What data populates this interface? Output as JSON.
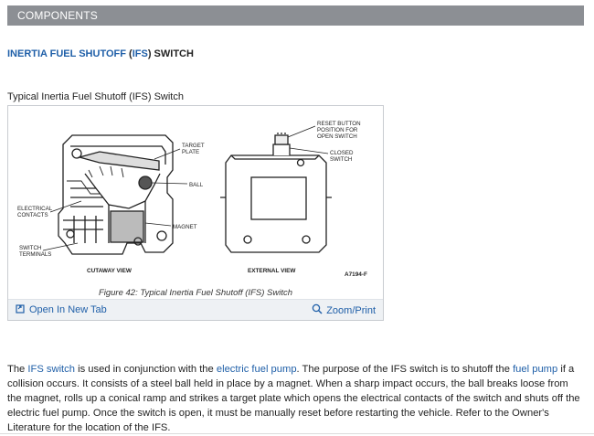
{
  "section_bar": {
    "label": "COMPONENTS"
  },
  "heading": {
    "part1": "INERTIA FUEL SHUTOFF",
    "part2": " (",
    "part3": "IFS",
    "part4": ") SWITCH"
  },
  "figure": {
    "title": "Typical Inertia Fuel Shutoff (IFS) Switch",
    "caption": "Figure 42: Typical Inertia Fuel Shutoff (IFS) Switch",
    "open_tab_label": "Open In New Tab",
    "zoom_label": "Zoom/Print",
    "diagram_labels": {
      "target_plate_1": "TARGET",
      "target_plate_2": "PLATE",
      "ball": "BALL",
      "contacts_1": "ELECTRICAL",
      "contacts_2": "CONTACTS",
      "magnet": "MAGNET",
      "terminals_1": "SWITCH",
      "terminals_2": "TERMINALS",
      "cutaway_view": "CUTAWAY VIEW",
      "reset_1": "RESET BUTTON",
      "reset_2": "POSITION FOR",
      "reset_3": "OPEN SWITCH",
      "closed_1": "CLOSED",
      "closed_2": "SWITCH",
      "external_view": "EXTERNAL VIEW",
      "figure_code": "A7194-F"
    }
  },
  "paragraph": {
    "t1": "The ",
    "l1": "IFS switch",
    "t2": " is used in conjunction with the ",
    "l2": "electric fuel pump",
    "t3": ". The purpose of the IFS switch is to shutoff the ",
    "l3": "fuel pump",
    "t4": " if a collision occurs. It consists of a steel ball held in place by a magnet. When a sharp impact occurs, the ball breaks loose from the magnet, rolls up a conical ramp and strikes a target plate which opens the electrical contacts of the switch and shuts off the electric fuel pump. Once the switch is open, it must be manually reset before restarting the vehicle. Refer to the Owner's Literature for the location of the IFS."
  }
}
